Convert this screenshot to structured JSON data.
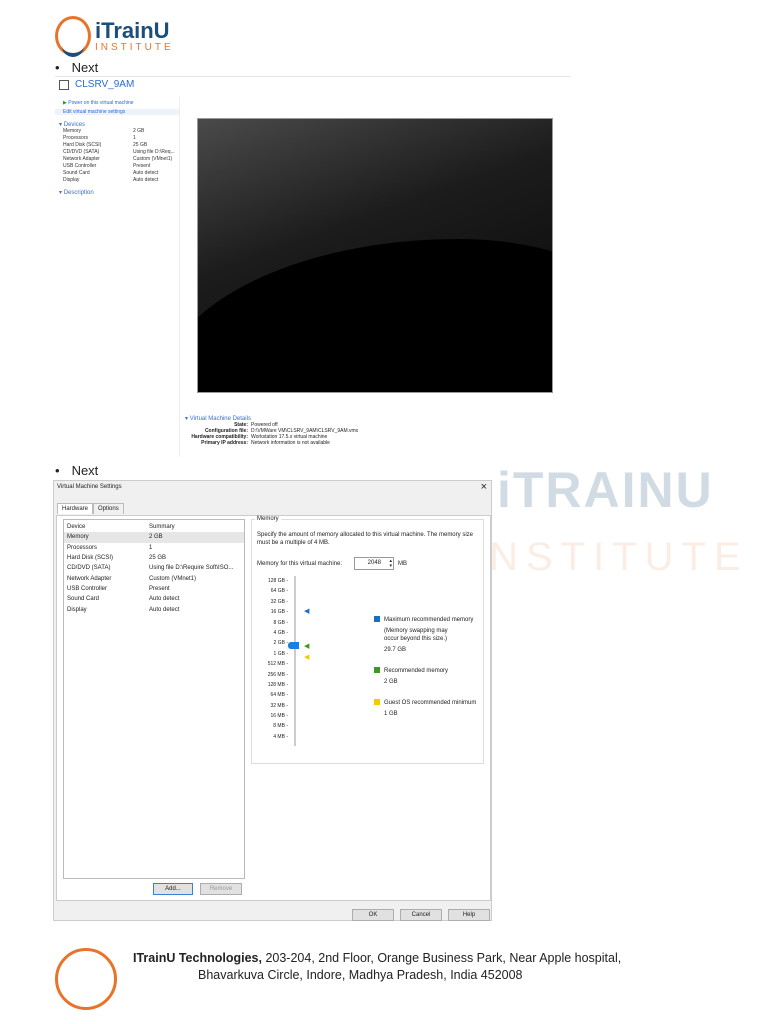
{
  "logo": {
    "name": "iTrainU",
    "sub": "INSTITUTE"
  },
  "bullets": [
    "Next",
    "Next"
  ],
  "watermark": {
    "main": "iTRAINU",
    "sub": "INSTITUTE"
  },
  "vm_summary": {
    "title": "CLSRV_9AM",
    "actions": [
      "Power on this virtual machine",
      "Edit virtual machine settings"
    ],
    "devices_header": "Devices",
    "devices": [
      [
        "Memory",
        "2 GB"
      ],
      [
        "Processors",
        "1"
      ],
      [
        "Hard Disk (SCSI)",
        "25 GB"
      ],
      [
        "CD/DVD (SATA)",
        "Using file D:\\Req..."
      ],
      [
        "Network Adapter",
        "Custom (VMnet1)"
      ],
      [
        "USB Controller",
        "Present"
      ],
      [
        "Sound Card",
        "Auto detect"
      ],
      [
        "Display",
        "Auto detect"
      ]
    ],
    "description_header": "Description",
    "details_header": "Virtual Machine Details",
    "details": [
      [
        "State:",
        "Powered off"
      ],
      [
        "Configuration file:",
        "D:\\VMWare VM\\CLSRV_9AM\\CLSRV_9AM.vmx"
      ],
      [
        "Hardware compatibility:",
        "Workstation 17.5.x virtual machine"
      ],
      [
        "Primary IP address:",
        "Network information is not available"
      ]
    ]
  },
  "dialog": {
    "title": "Virtual Machine Settings",
    "close": "×",
    "tabs": [
      "Hardware",
      "Options"
    ],
    "columns": [
      "Device",
      "Summary"
    ],
    "devices": [
      [
        "Memory",
        "2 GB"
      ],
      [
        "Processors",
        "1"
      ],
      [
        "Hard Disk (SCSI)",
        "25 GB"
      ],
      [
        "CD/DVD (SATA)",
        "Using file D:\\Require Soft\\ISO..."
      ],
      [
        "Network Adapter",
        "Custom (VMnet1)"
      ],
      [
        "USB Controller",
        "Present"
      ],
      [
        "Sound Card",
        "Auto detect"
      ],
      [
        "Display",
        "Auto detect"
      ]
    ],
    "add": "Add...",
    "remove": "Remove",
    "memory": {
      "group": "Memory",
      "desc": "Specify the amount of memory allocated to this virtual machine. The memory size must be a multiple of 4 MB.",
      "label": "Memory for this virtual machine:",
      "value": "2048",
      "unit": "MB",
      "scale": [
        "128 GB",
        "64 GB",
        "32 GB",
        "16 GB",
        "8 GB",
        "4 GB",
        "2 GB",
        "1 GB",
        "512 MB",
        "256 MB",
        "128 MB",
        "64 MB",
        "32 MB",
        "16 MB",
        "8 MB",
        "4 MB"
      ],
      "legend": {
        "max_label": "Maximum recommended memory",
        "max_note": "(Memory swapping may occur beyond this size.)",
        "max_value": "29.7 GB",
        "rec_label": "Recommended memory",
        "rec_value": "2 GB",
        "min_label": "Guest OS recommended minimum",
        "min_value": "1 GB"
      },
      "colors": {
        "max": "#1a6fc4",
        "rec": "#3d9a1f",
        "min": "#f0cc00"
      }
    },
    "ok": "OK",
    "cancel": "Cancel",
    "help": "Help"
  },
  "footer": {
    "company": "ITrainU Technologies,",
    "line1": " 203-204, 2nd Floor, Orange Business Park, Near Apple hospital,",
    "line2": "Bhavarkuva Circle, Indore, Madhya Pradesh, India 452008"
  }
}
